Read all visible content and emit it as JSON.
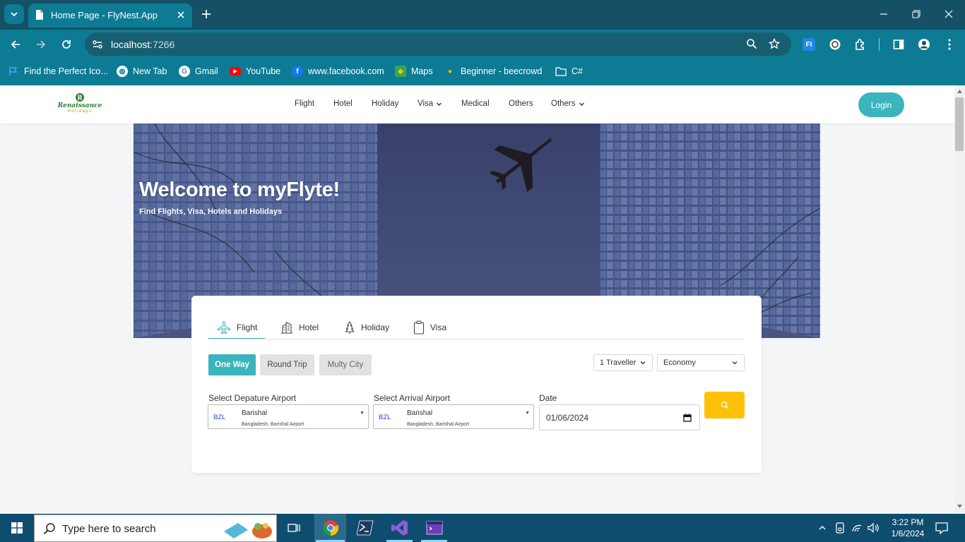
{
  "browser": {
    "tab_title": "Home Page - FlyNest.App",
    "url_host": "localhost",
    "url_port": ":7266",
    "bookmarks": [
      {
        "label": "Find the Perfect Ico...",
        "icon": "flag-icon"
      },
      {
        "label": "New Tab",
        "icon": "globe-icon"
      },
      {
        "label": "Gmail",
        "icon": "google-icon"
      },
      {
        "label": "YouTube",
        "icon": "youtube-icon"
      },
      {
        "label": "www.facebook.com",
        "icon": "facebook-icon"
      },
      {
        "label": "Maps",
        "icon": "maps-icon"
      },
      {
        "label": "Beginner - beecrowd",
        "icon": "beecrowd-icon"
      },
      {
        "label": "C#",
        "icon": "folder-icon"
      }
    ],
    "extension_label": "FI"
  },
  "site": {
    "logo_text": "Renaissance",
    "logo_sub": "Holidays",
    "nav": [
      {
        "label": "Flight",
        "has_caret": false
      },
      {
        "label": "Hotel",
        "has_caret": false
      },
      {
        "label": "Holiday",
        "has_caret": false
      },
      {
        "label": "Visa",
        "has_caret": true
      },
      {
        "label": "Medical",
        "has_caret": false
      },
      {
        "label": "Others",
        "has_caret": false
      },
      {
        "label": "Others",
        "has_caret": true
      }
    ],
    "login_label": "Login"
  },
  "hero": {
    "title": "Welcome to myFlyte!",
    "subtitle": "Find Flights, Visa, Hotels and Holidays"
  },
  "search": {
    "tabs": [
      {
        "label": "Flight",
        "icon": "airplane-icon",
        "active": true
      },
      {
        "label": "Hotel",
        "icon": "building-icon",
        "active": false
      },
      {
        "label": "Holiday",
        "icon": "tree-icon",
        "active": false
      },
      {
        "label": "Visa",
        "icon": "clipboard-icon",
        "active": false
      }
    ],
    "trip_types": [
      {
        "label": "One Way",
        "active": true
      },
      {
        "label": "Round Trip",
        "active": false
      },
      {
        "label": "Multy City",
        "active": false
      }
    ],
    "travellers": "1 Traveller",
    "cabin_class": "Economy",
    "departure_label": "Select Depature Airport",
    "arrival_label": "Select Arrival Airport",
    "date_label": "Date",
    "departure": {
      "code": "BZL",
      "city": "Barishal",
      "detail": "Bangladesh, Barishal Airport"
    },
    "arrival": {
      "code": "BZL",
      "city": "Barishal",
      "detail": "Bangladesh, Barishal Airport"
    },
    "date_value": "01/06/2024"
  },
  "taskbar": {
    "search_placeholder": "Type here to search",
    "time": "3:22 PM",
    "date": "1/6/2024"
  },
  "colors": {
    "accent": "#3ab5bd",
    "search_button": "#ffc107",
    "browser_frame": "#0d7b94"
  }
}
